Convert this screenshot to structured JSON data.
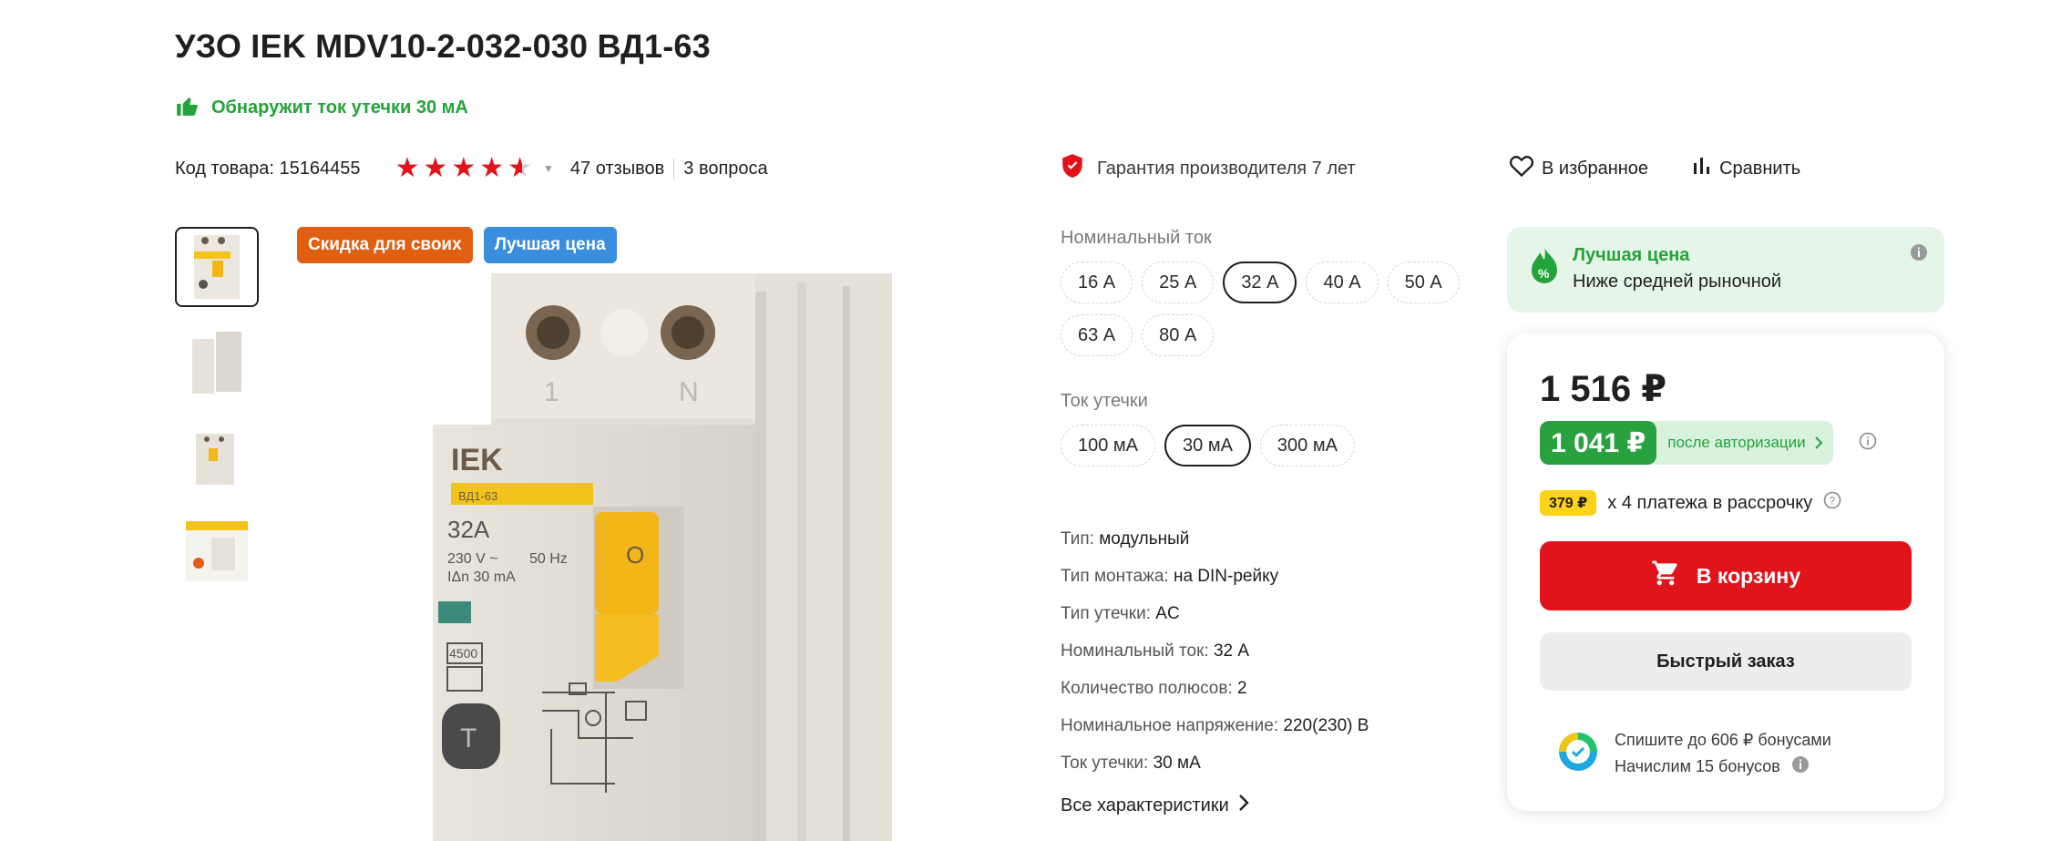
{
  "product": {
    "title": "УЗО IEK MDV10-2-032-030 ВД1-63",
    "feature": "Обнаружит ток утечки 30 мА",
    "code_label": "Код товара: 15164455",
    "rating": 4.5,
    "reviews": "47 отзывов",
    "questions": "3 вопроса"
  },
  "guarantee": "Гарантия производителя 7 лет",
  "actions": {
    "favorite": "В избранное",
    "compare": "Сравнить"
  },
  "badges": {
    "discount": "Скидка для своих",
    "best": "Лучшая цена"
  },
  "image_labels": {
    "brand": "IEK",
    "model": "ВД1-63",
    "current": "32A",
    "voltage": "230 V ~",
    "leak": "IΔn 30 mA",
    "freq": "50 Hz",
    "rating": "4500",
    "test": "T",
    "o": "O",
    "n": "N",
    "one": "1"
  },
  "options": {
    "nominal_label": "Номинальный ток",
    "nominal": [
      "16 А",
      "25 А",
      "32 А",
      "40 А",
      "50 А",
      "63 А",
      "80 А"
    ],
    "nominal_selected": "32 А",
    "leak_label": "Ток утечки",
    "leak": [
      "100 мА",
      "30 мА",
      "300 мА"
    ],
    "leak_selected": "30 мА"
  },
  "specs": [
    {
      "k": "Тип:",
      "v": "модульный"
    },
    {
      "k": "Тип монтажа:",
      "v": "на DIN-рейку"
    },
    {
      "k": "Тип утечки:",
      "v": "AC"
    },
    {
      "k": "Номинальный ток:",
      "v": "32 А"
    },
    {
      "k": "Количество полюсов:",
      "v": "2"
    },
    {
      "k": "Номинальное напряжение:",
      "v": "220(230) В"
    },
    {
      "k": "Ток утечки:",
      "v": "30 мА"
    }
  ],
  "all_specs": "Все характеристики",
  "best_price": {
    "title": "Лучшая цена",
    "subtitle": "Ниже средней рыночной"
  },
  "buy": {
    "price": "1 516 ₽",
    "auth_price": "1 041 ₽",
    "auth_note": "после авторизации",
    "installment_value": "379 ₽",
    "installment_text": "х 4 платежа в рассрочку",
    "cart": "В корзину",
    "quick": "Быстрый заказ",
    "bonus_spend": "Спишите до 606 ₽ бонусами",
    "bonus_earn": "Начислим 15 бонусов"
  },
  "colors": {
    "accent_red": "#e1131b",
    "green": "#23a33a",
    "orange": "#e05f10",
    "blue": "#3a8ee0",
    "yellow": "#fcd21a"
  }
}
